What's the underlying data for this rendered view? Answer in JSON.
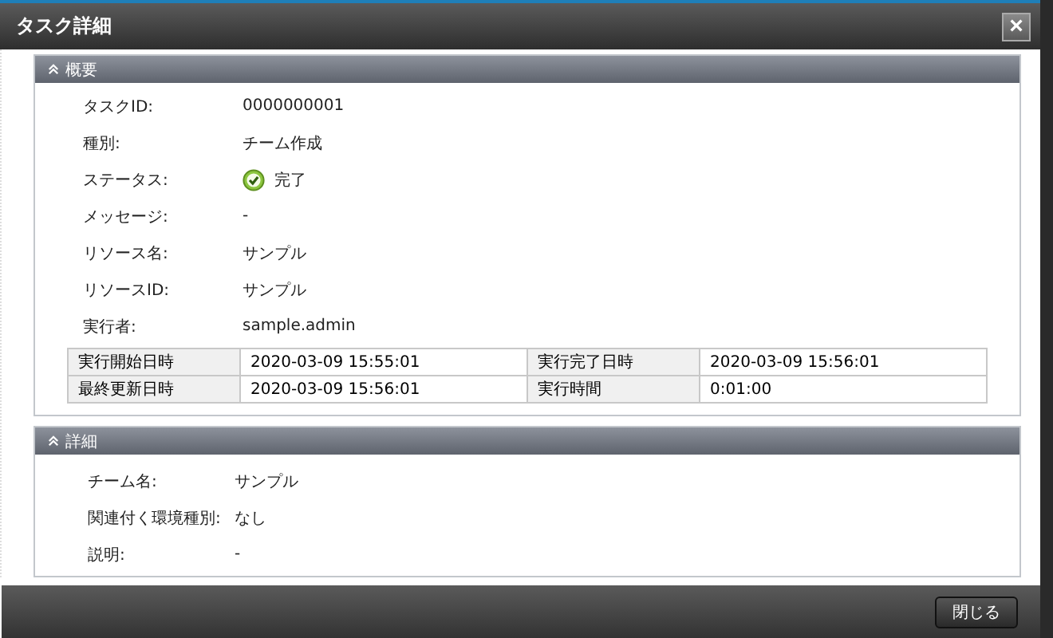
{
  "window": {
    "title": "タスク詳細",
    "close": "×"
  },
  "sections": [
    {
      "title": "概要",
      "expanded": true,
      "rows": [
        {
          "kind": "text",
          "label": "タスクID:",
          "value": "0000000001"
        },
        {
          "kind": "text",
          "label": "種別:",
          "value": "チーム作成"
        },
        {
          "kind": "status",
          "label": "ステータス:",
          "value": "完了"
        },
        {
          "kind": "text",
          "label": "メッセージ:",
          "value": "-"
        },
        {
          "kind": "text",
          "label": "リソース名:",
          "value": "サンプル"
        },
        {
          "kind": "text",
          "label": "リソースID:",
          "value": "サンプル"
        },
        {
          "kind": "text",
          "label": "実行者:",
          "value": "sample.admin"
        }
      ],
      "table": [
        [
          "実行開始日時",
          "2020-03-09 15:55:01",
          "実行完了日時",
          "2020-03-09 15:56:01"
        ],
        [
          "最終更新日時",
          "2020-03-09 15:56:01",
          "実行時間",
          "0:01:00"
        ]
      ]
    },
    {
      "title": "詳細",
      "expanded": true,
      "rows": [
        {
          "kind": "text",
          "label": "チーム名:",
          "value": "サンプル"
        },
        {
          "kind": "text",
          "label": "関連付く環境種別:",
          "value": "なし"
        },
        {
          "kind": "text",
          "label": "説明:",
          "value": "-"
        }
      ]
    }
  ],
  "footer": {
    "button": "閉じる"
  }
}
